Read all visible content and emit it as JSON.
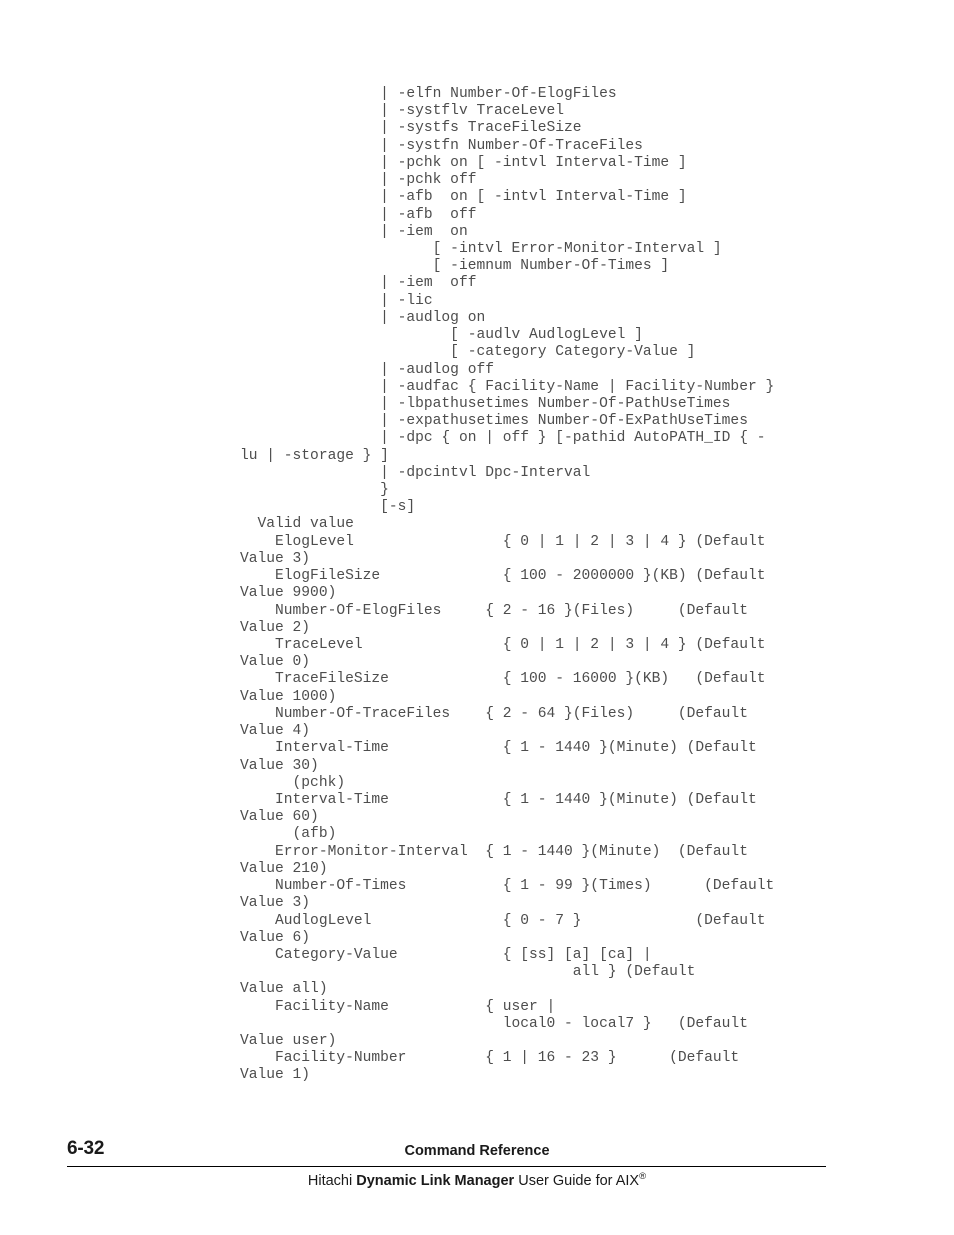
{
  "document": {
    "page_label": "6-32",
    "section_title": "Command Reference",
    "guide_title_prefix": "Hitachi ",
    "guide_title_bold": "Dynamic Link Manager",
    "guide_title_suffix": " User Guide for AIX",
    "registered_mark": "®"
  },
  "code_block": {
    "lines": [
      "                | -elfn Number-Of-ElogFiles",
      "                | -systflv TraceLevel",
      "                | -systfs TraceFileSize",
      "                | -systfn Number-Of-TraceFiles",
      "                | -pchk on [ -intvl Interval-Time ]",
      "                | -pchk off",
      "                | -afb  on [ -intvl Interval-Time ]",
      "                | -afb  off",
      "                | -iem  on",
      "                      [ -intvl Error-Monitor-Interval ]",
      "                      [ -iemnum Number-Of-Times ]",
      "                | -iem  off",
      "                | -lic",
      "                | -audlog on",
      "                        [ -audlv AudlogLevel ]",
      "                        [ -category Category-Value ]",
      "                | -audlog off",
      "                | -audfac { Facility-Name | Facility-Number }",
      "                | -lbpathusetimes Number-Of-PathUseTimes",
      "                | -expathusetimes Number-Of-ExPathUseTimes",
      "                | -dpc { on | off } [-pathid AutoPATH_ID { -",
      "lu | -storage } ]",
      "                | -dpcintvl Dpc-Interval",
      "                }",
      "                [-s]",
      "  Valid value",
      "    ElogLevel                 { 0 | 1 | 2 | 3 | 4 } (Default",
      "Value 3)",
      "    ElogFileSize              { 100 - 2000000 }(KB) (Default",
      "Value 9900)",
      "    Number-Of-ElogFiles     { 2 - 16 }(Files)     (Default",
      "Value 2)",
      "    TraceLevel                { 0 | 1 | 2 | 3 | 4 } (Default",
      "Value 0)",
      "    TraceFileSize             { 100 - 16000 }(KB)   (Default",
      "Value 1000)",
      "    Number-Of-TraceFiles    { 2 - 64 }(Files)     (Default",
      "Value 4)",
      "    Interval-Time             { 1 - 1440 }(Minute) (Default",
      "Value 30)",
      "      (pchk)",
      "    Interval-Time             { 1 - 1440 }(Minute) (Default",
      "Value 60)",
      "      (afb)",
      "    Error-Monitor-Interval  { 1 - 1440 }(Minute)  (Default",
      "Value 210)",
      "    Number-Of-Times           { 1 - 99 }(Times)      (Default",
      "Value 3)",
      "    AudlogLevel               { 0 - 7 }             (Default",
      "Value 6)",
      "    Category-Value            { [ss] [a] [ca] |",
      "                                      all } (Default",
      "Value all)",
      "    Facility-Name           { user |",
      "                              local0 - local7 }   (Default",
      "Value user)",
      "    Facility-Number         { 1 | 16 - 23 }      (Default",
      "Value 1)"
    ]
  },
  "syntax_options": [
    {
      "option": "-elfn",
      "argument": "Number-Of-ElogFiles"
    },
    {
      "option": "-systflv",
      "argument": "TraceLevel"
    },
    {
      "option": "-systfs",
      "argument": "TraceFileSize"
    },
    {
      "option": "-systfn",
      "argument": "Number-Of-TraceFiles"
    },
    {
      "option": "-pchk on",
      "argument": "[ -intvl Interval-Time ]"
    },
    {
      "option": "-pchk off",
      "argument": ""
    },
    {
      "option": "-afb on",
      "argument": "[ -intvl Interval-Time ]"
    },
    {
      "option": "-afb off",
      "argument": ""
    },
    {
      "option": "-iem on",
      "argument": "[ -intvl Error-Monitor-Interval ] [ -iemnum Number-Of-Times ]"
    },
    {
      "option": "-iem off",
      "argument": ""
    },
    {
      "option": "-lic",
      "argument": ""
    },
    {
      "option": "-audlog on",
      "argument": "[ -audlv AudlogLevel ] [ -category Category-Value ]"
    },
    {
      "option": "-audlog off",
      "argument": ""
    },
    {
      "option": "-audfac",
      "argument": "{ Facility-Name | Facility-Number }"
    },
    {
      "option": "-lbpathusetimes",
      "argument": "Number-Of-PathUseTimes"
    },
    {
      "option": "-expathusetimes",
      "argument": "Number-Of-ExPathUseTimes"
    },
    {
      "option": "-dpc",
      "argument": "{ on | off } [-pathid AutoPATH_ID { -lu | -storage } ]"
    },
    {
      "option": "-dpcintvl",
      "argument": "Dpc-Interval"
    },
    {
      "option": "-s",
      "argument": ""
    }
  ],
  "valid_value_table": {
    "heading": "Valid value",
    "rows": [
      {
        "name": "ElogLevel",
        "range": "{ 0 | 1 | 2 | 3 | 4 }",
        "unit": "",
        "default": "(Default Value 3)"
      },
      {
        "name": "ElogFileSize",
        "range": "{ 100 - 2000000 }",
        "unit": "(KB)",
        "default": "(Default Value 9900)"
      },
      {
        "name": "Number-Of-ElogFiles",
        "range": "{ 2 - 16 }",
        "unit": "(Files)",
        "default": "(Default Value 2)"
      },
      {
        "name": "TraceLevel",
        "range": "{ 0 | 1 | 2 | 3 | 4 }",
        "unit": "",
        "default": "(Default Value 0)"
      },
      {
        "name": "TraceFileSize",
        "range": "{ 100 - 16000 }",
        "unit": "(KB)",
        "default": "(Default Value 1000)"
      },
      {
        "name": "Number-Of-TraceFiles",
        "range": "{ 2 - 64 }",
        "unit": "(Files)",
        "default": "(Default Value 4)"
      },
      {
        "name": "Interval-Time (pchk)",
        "range": "{ 1 - 1440 }",
        "unit": "(Minute)",
        "default": "(Default Value 30)"
      },
      {
        "name": "Interval-Time (afb)",
        "range": "{ 1 - 1440 }",
        "unit": "(Minute)",
        "default": "(Default Value 60)"
      },
      {
        "name": "Error-Monitor-Interval",
        "range": "{ 1 - 1440 }",
        "unit": "(Minute)",
        "default": "(Default Value 210)"
      },
      {
        "name": "Number-Of-Times",
        "range": "{ 1 - 99 }",
        "unit": "(Times)",
        "default": "(Default Value 3)"
      },
      {
        "name": "AudlogLevel",
        "range": "{ 0 - 7 }",
        "unit": "",
        "default": "(Default Value 6)"
      },
      {
        "name": "Category-Value",
        "range": "{ [ss] [a] [ca] | all }",
        "unit": "",
        "default": "(Default Value all)"
      },
      {
        "name": "Facility-Name",
        "range": "{ user | local0 - local7 }",
        "unit": "",
        "default": "(Default Value user)"
      },
      {
        "name": "Facility-Number",
        "range": "{ 1 | 16 - 23 }",
        "unit": "",
        "default": "(Default Value 1)"
      }
    ]
  }
}
